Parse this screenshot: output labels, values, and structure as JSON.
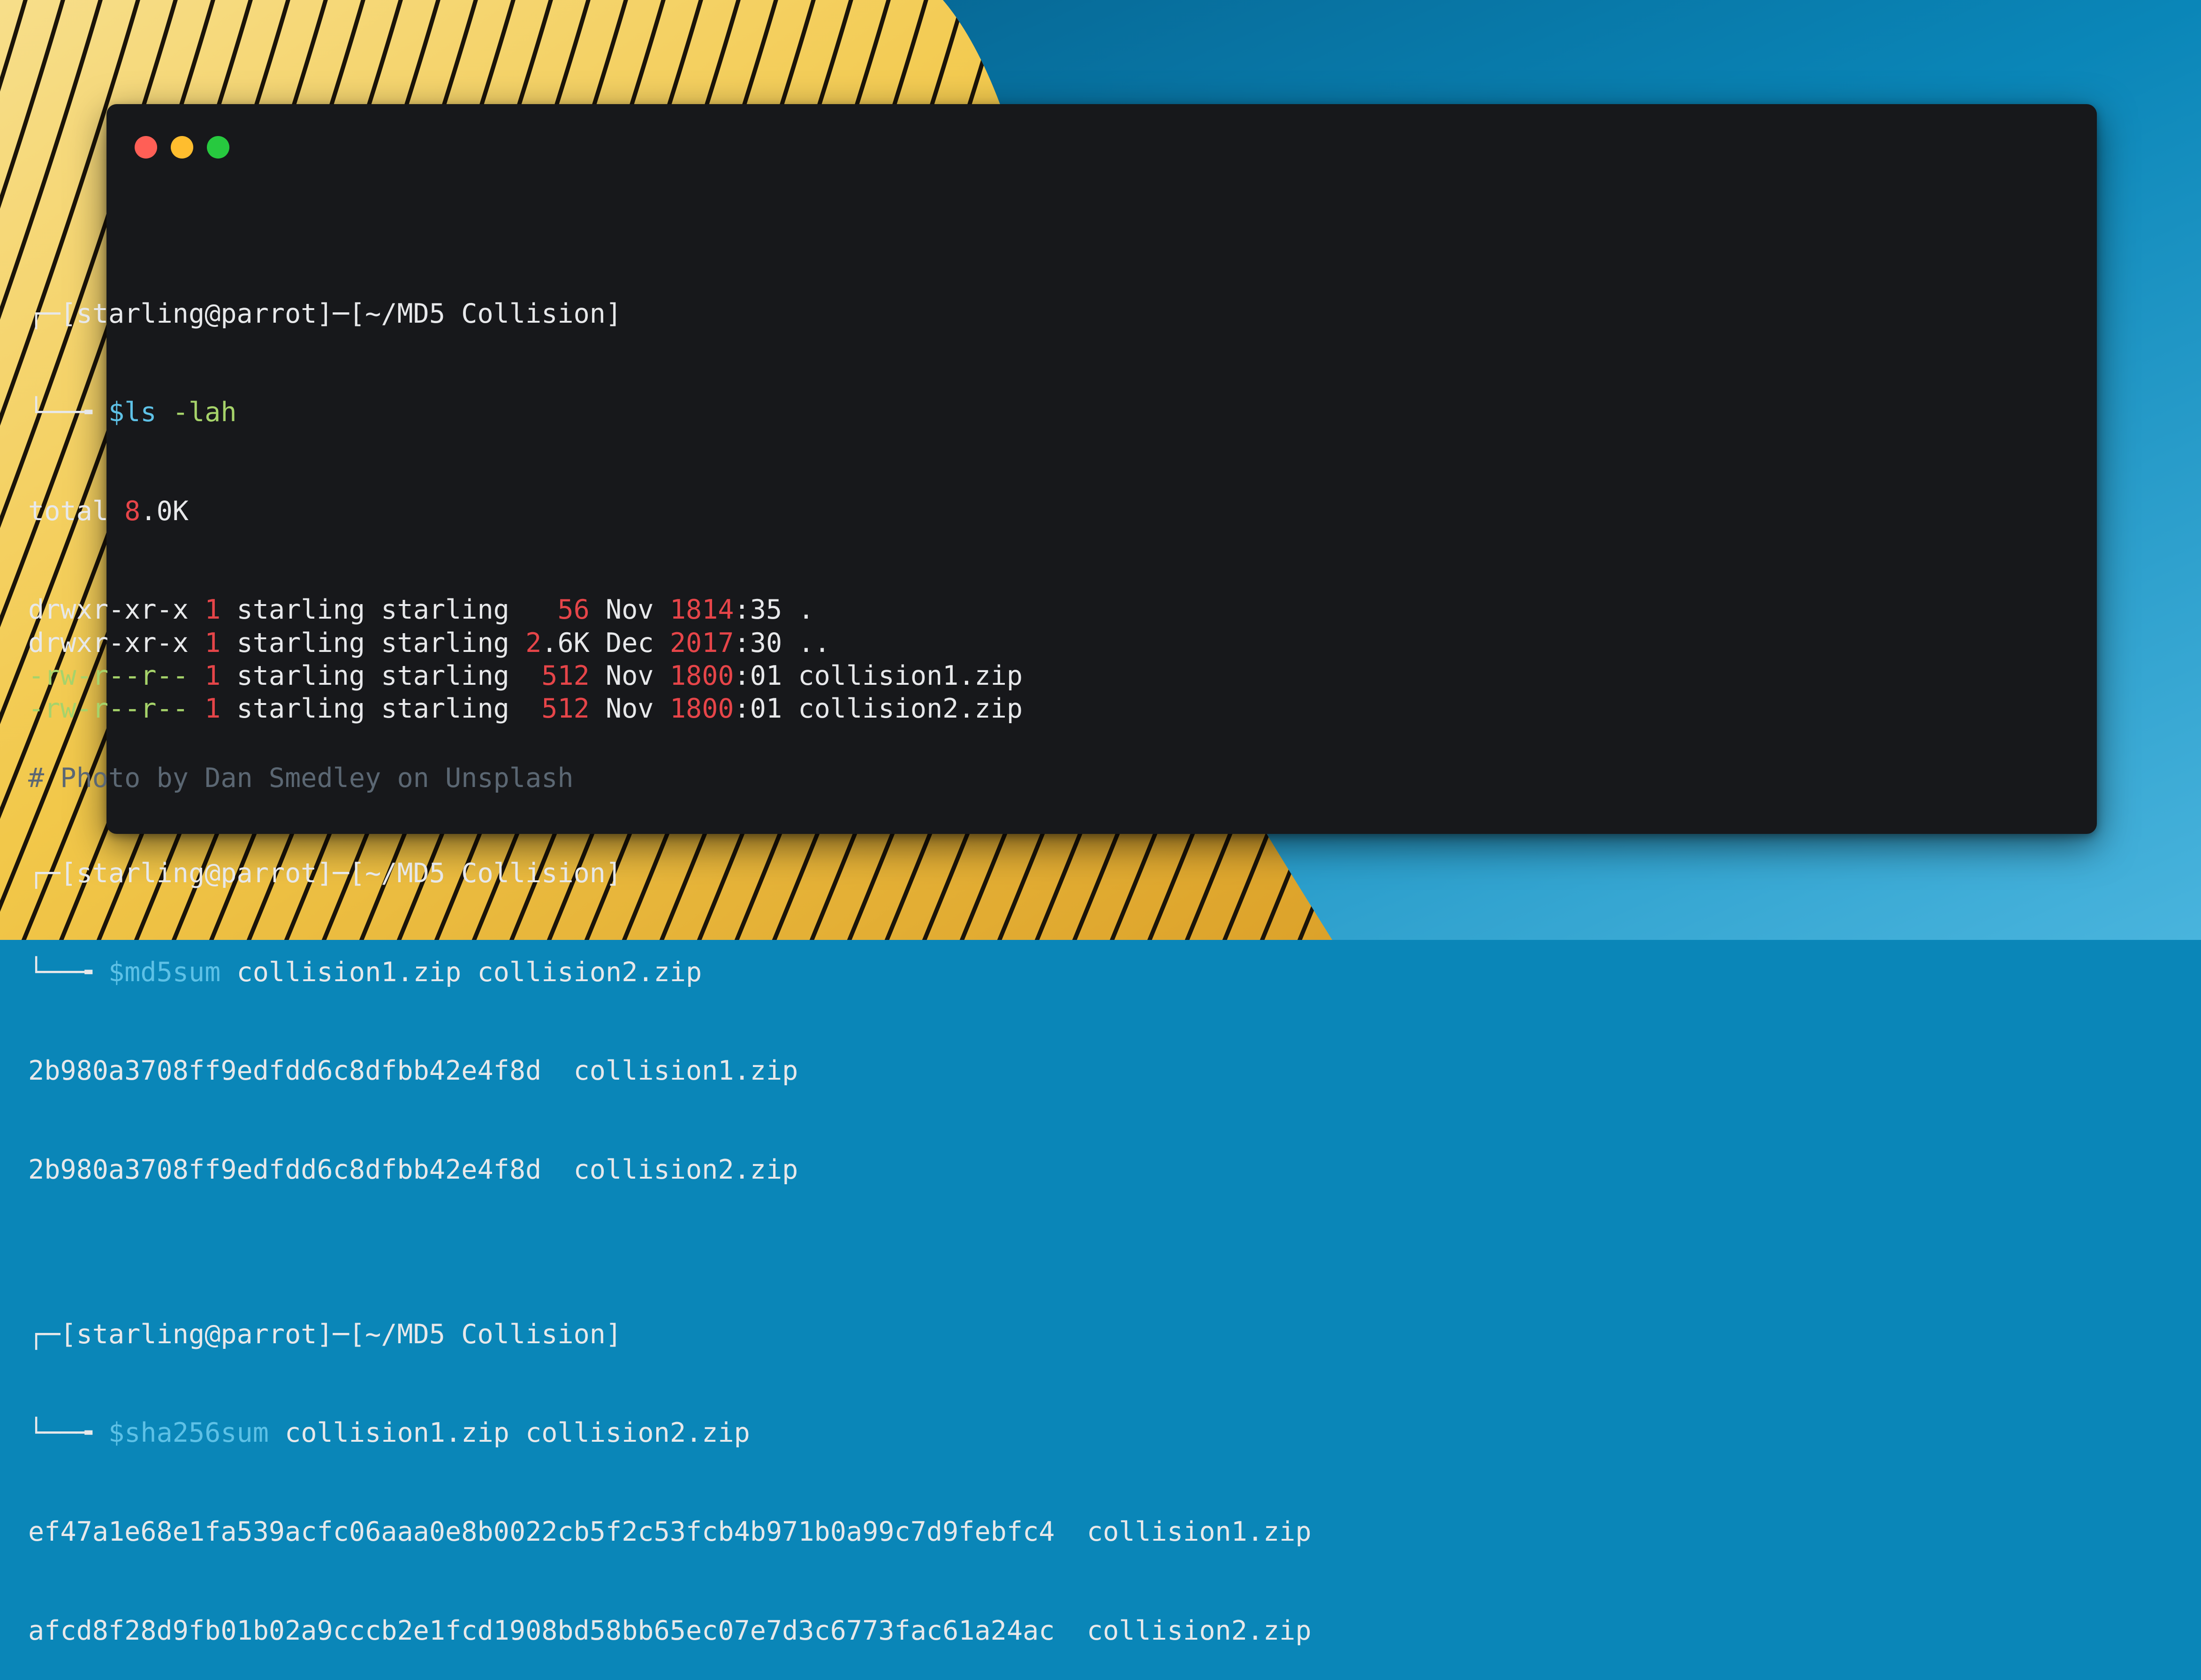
{
  "window": {
    "controls": [
      "close",
      "minimize",
      "maximize"
    ],
    "colors": {
      "close": "#ff5f56",
      "minimize": "#ffbd2e",
      "maximize": "#27c93f"
    }
  },
  "terminal": {
    "prompt": {
      "header": "┌─[starling@parrot]─[~/MD5 Collision]",
      "branch": "└──╼ ",
      "sigil": "$"
    },
    "commands": {
      "ls": {
        "cmd": "ls",
        "args": "-lah"
      },
      "md5": {
        "cmd": "md5sum",
        "args": " collision1.zip collision2.zip"
      },
      "sha": {
        "cmd": "sha256sum",
        "args": " collision1.zip collision2.zip"
      }
    },
    "ls_output": {
      "total_label": "total ",
      "total_num": "8",
      "total_rest": ".0K",
      "rows": [
        {
          "perms": "drwxr-xr-x",
          "links": "1",
          "owner": " starling starling ",
          "size_num": "  56",
          "size_rest": "",
          "month": " Nov ",
          "day": "18",
          "hour": "14",
          "min": ":35",
          "name": " ."
        },
        {
          "perms": "drwxr-xr-x",
          "links": "1",
          "owner": " starling starling ",
          "size_num": "2",
          "size_rest": ".6K",
          "month": " Dec ",
          "day": "20",
          "hour": "17",
          "min": ":30",
          "name": " .."
        },
        {
          "perms": "-rw-r--r--",
          "links": "1",
          "owner": " starling starling ",
          "size_num": " 512",
          "size_rest": "",
          "month": " Nov ",
          "day": "18",
          "hour": "00",
          "min": ":01",
          "name": " collision1.zip"
        },
        {
          "perms": "-rw-r--r--",
          "links": "1",
          "owner": " starling starling ",
          "size_num": " 512",
          "size_rest": "",
          "month": " Nov ",
          "day": "18",
          "hour": "00",
          "min": ":01",
          "name": " collision2.zip"
        }
      ]
    },
    "md5_output": [
      "2b980a3708ff9edfdd6c8dfbb42e4f8d  collision1.zip",
      "2b980a3708ff9edfdd6c8dfbb42e4f8d  collision2.zip"
    ],
    "sha_output": [
      "ef47a1e68e1fa539acfc06aaa0e8b0022cb5f2c53fcb4b971b0a99c7d9febfc4  collision1.zip",
      "afcd8f28d9fb01b02a9cccb2e1fcd1908bd58bb65ec07e7d3c6773fac61a24ac  collision2.zip"
    ]
  },
  "footer_comment": "# Photo by Dan Smedley on Unsplash",
  "colors": {
    "window_bg": "#17181b",
    "text": "#e7e8ea",
    "command": "#5ec1e6",
    "argument": "#a6d36a",
    "number": "#e64549",
    "comment": "#5b6773",
    "backdrop_gold": "#f1c84a",
    "backdrop_blue": "#0a86b8"
  }
}
